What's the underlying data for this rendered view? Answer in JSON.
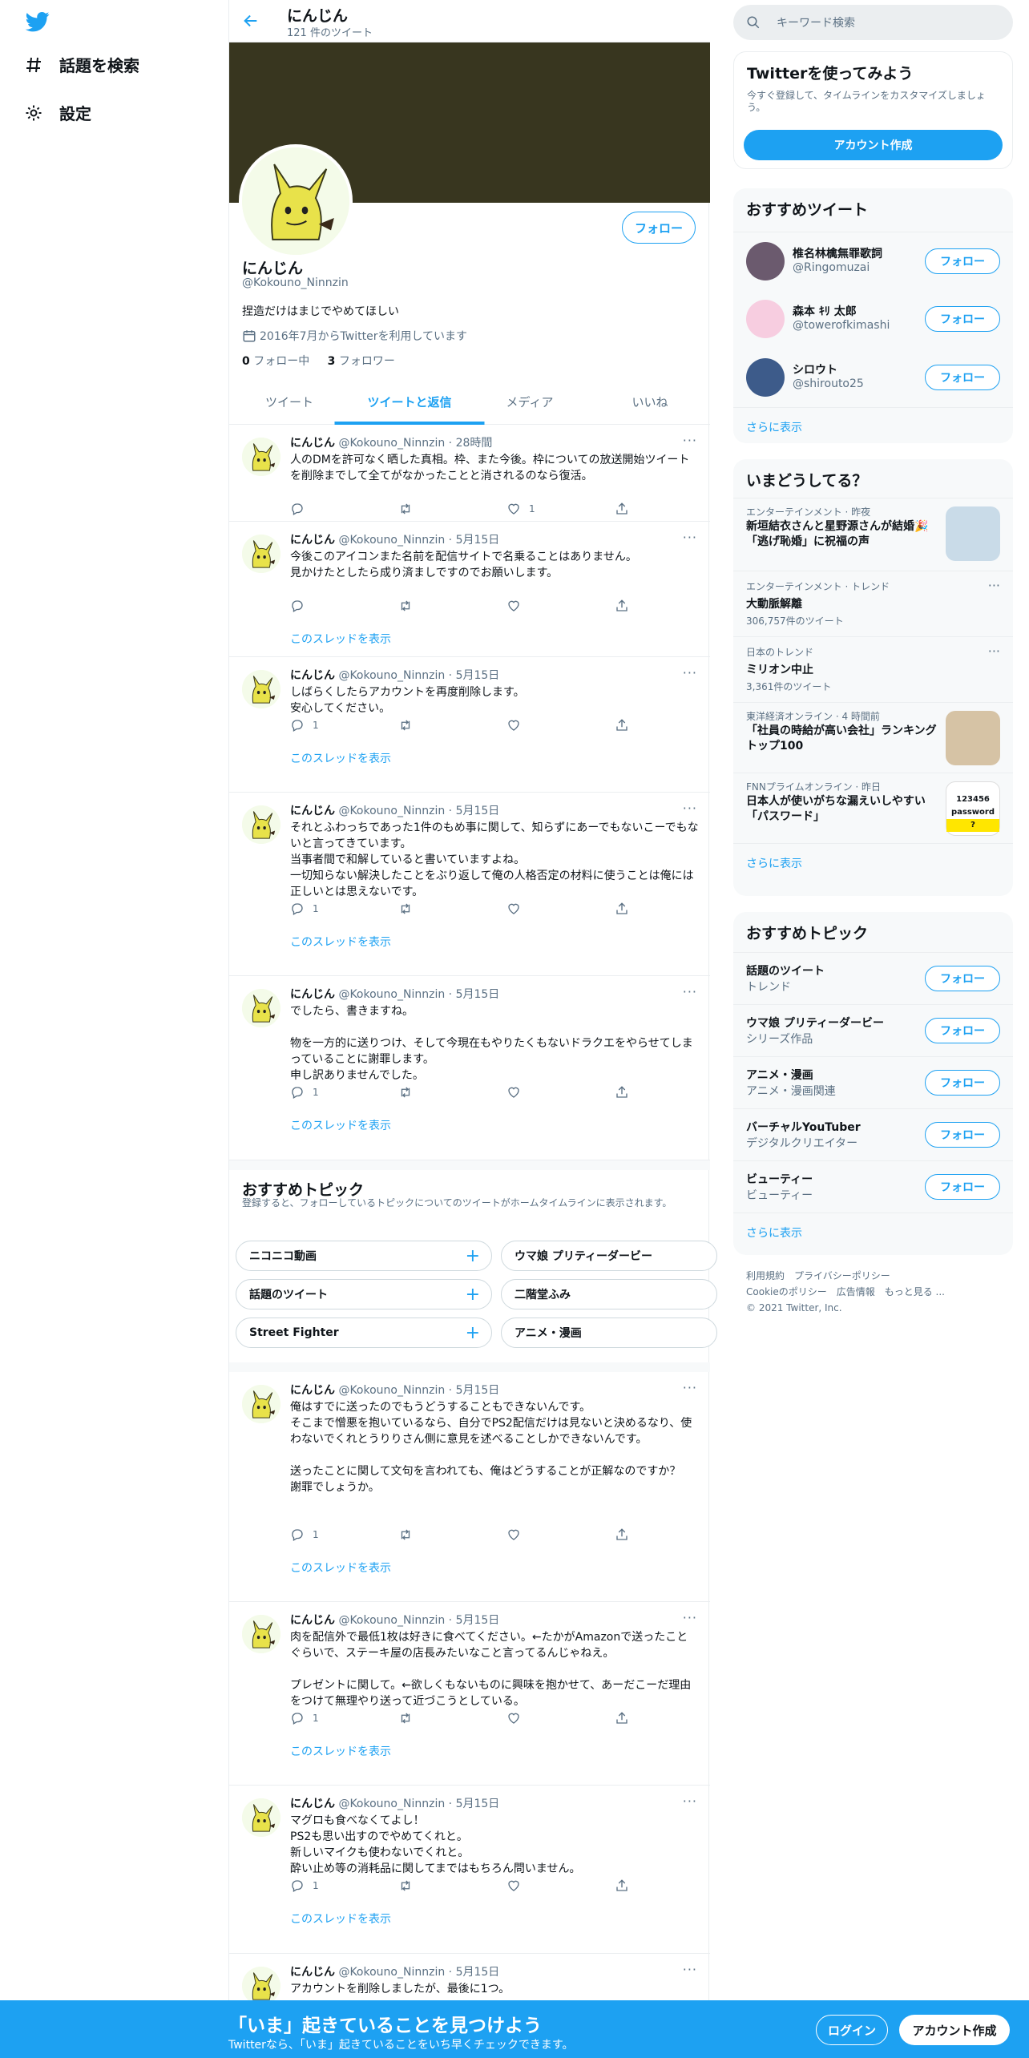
{
  "nav": {
    "explore": "話題を検索",
    "settings": "設定"
  },
  "header": {
    "name": "にんじん",
    "count": "121 件のツイート"
  },
  "profile": {
    "follow": "フォロー",
    "name": "にんじん",
    "handle": "@Kokouno_Ninnzin",
    "bio": "捏造だけはまじでやめてほしい",
    "joined": "2016年7月からTwitterを利用しています",
    "following_num": "0",
    "following_label": "フォロー中",
    "followers_num": "3",
    "followers_label": "フォロワー"
  },
  "tabs": [
    "ツイート",
    "ツイートと返信",
    "メディア",
    "いいね"
  ],
  "thread_label": "このスレッドを表示",
  "tweets": [
    {
      "name": "にんじん",
      "handle": "@Kokouno_Ninnzin",
      "time": "· 28時間",
      "text": "人のDMを許可なく晒した真相。枠、また今後。枠についての放送開始ツイートを削除までして全てがなかったことと消されるのなら復活。",
      "reply": "",
      "rt": "",
      "like": "1"
    },
    {
      "name": "にんじん",
      "handle": "@Kokouno_Ninnzin",
      "time": "· 5月15日",
      "text": "今後このアイコンまた名前を配信サイトで名乗ることはありません。\n見かけたとしたら成り済ましですのでお願いします。",
      "reply": "",
      "rt": "",
      "like": ""
    },
    {
      "name": "にんじん",
      "handle": "@Kokouno_Ninnzin",
      "time": "· 5月15日",
      "text": "しばらくしたらアカウントを再度削除します。\n安心してください。",
      "reply": "1",
      "rt": "",
      "like": ""
    },
    {
      "name": "にんじん",
      "handle": "@Kokouno_Ninnzin",
      "time": "· 5月15日",
      "text": "それとふわっちであった1件のもめ事に関して、知らずにあーでもないこーでもないと言ってきています。\n当事者間で和解していると書いていますよね。\n一切知らない解決したことをぶり返して俺の人格否定の材料に使うことは俺には正しいとは思えないです。",
      "reply": "1",
      "rt": "",
      "like": ""
    },
    {
      "name": "にんじん",
      "handle": "@Kokouno_Ninnzin",
      "time": "· 5月15日",
      "text": "でしたら、書きますね。\n\n物を一方的に送りつけ、そして今現在もやりたくもないドラクエをやらせてしまっていることに謝罪します。\n申し訳ありませんでした。",
      "reply": "1",
      "rt": "",
      "like": ""
    },
    {
      "name": "にんじん",
      "handle": "@Kokouno_Ninnzin",
      "time": "· 5月15日",
      "text": "俺はすでに送ったのでもうどうすることもできないんです。\nそこまで憎悪を抱いているなら、自分でPS2配信だけは見ないと決めるなり、使わないでくれとうりりさん側に意見を述べることしかできないんです。\n\n送ったことに関して文句を言われても、俺はどうすることが正解なのですか？\n謝罪でしょうか。",
      "reply": "1",
      "rt": "",
      "like": ""
    },
    {
      "name": "にんじん",
      "handle": "@Kokouno_Ninnzin",
      "time": "· 5月15日",
      "text": "肉を配信外で最低1枚は好きに食べてください。←たかがAmazonで送ったことぐらいで、ステーキ屋の店長みたいなこと言ってるんじゃねえ。\n\nプレゼントに関して。←欲しくもないものに興味を抱かせて、あーだこーだ理由をつけて無理やり送って近づこうとしている。",
      "reply": "1",
      "rt": "",
      "like": ""
    },
    {
      "name": "にんじん",
      "handle": "@Kokouno_Ninnzin",
      "time": "· 5月15日",
      "text": "マグロも食べなくてよし！\nPS2も思い出すのでやめてくれと。\n新しいマイクも使わないでくれと。\n酔い止め等の消耗品に関してまではもちろん問いません。",
      "reply": "1",
      "rt": "",
      "like": ""
    },
    {
      "name": "にんじん",
      "handle": "@Kokouno_Ninnzin",
      "time": "· 5月15日",
      "text": "アカウントを削除しましたが、最後に1つ。",
      "reply": "",
      "rt": "",
      "like": ""
    }
  ],
  "topics": {
    "title": "おすすめトピック",
    "desc": "登録すると、フォローしているトピックについてのツイートがホームタイムラインに表示されます。",
    "chips": [
      "ニコニコ動画",
      "ウマ娘 プリティーダービー",
      "話題のツイート",
      "二階堂ふみ",
      "Street Fighter",
      "アニメ・漫画"
    ]
  },
  "search": {
    "placeholder": "キーワード検索"
  },
  "signup": {
    "title": "Twitterを使ってみよう",
    "desc": "今すぐ登録して、タイムラインをカスタマイズしましょう。",
    "button": "アカウント作成"
  },
  "whotofollow": {
    "title": "おすすめツイート",
    "users": [
      {
        "name": "椎名林檎無罪歌詞",
        "handle": "@Ringomuzai"
      },
      {
        "name": "森本 ｷﾘ 太郎",
        "handle": "@towerofkimashi"
      },
      {
        "name": "シロウト",
        "handle": "@shirouto25"
      }
    ],
    "button": "フォロー",
    "more": "さらに表示"
  },
  "trends": {
    "title": "いまどうしてる？",
    "items": [
      {
        "meta": "エンターテインメント · 昨夜",
        "title": "新垣結衣さんと星野源さんが結婚🎉「逃げ恥婚」に祝福の声",
        "count": ""
      },
      {
        "meta": "エンターテインメント · トレンド",
        "title": "大動脈解離",
        "count": "306,757件のツイート"
      },
      {
        "meta": "日本のトレンド",
        "title": "ミリオン中止",
        "count": "3,361件のツイート"
      },
      {
        "meta": "東洋経済オンライン · 4 時間前",
        "title": "「社員の時給が高い会社」ランキングトップ100",
        "count": ""
      },
      {
        "meta": "FNNプライムオンライン · 昨日",
        "title": "日本人が使いがちな漏えいしやすい「パスワード」",
        "count": ""
      }
    ],
    "more": "さらに表示",
    "thumb_text": [
      "123456",
      "password",
      "?"
    ]
  },
  "rtopics": {
    "title": "おすすめトピック",
    "items": [
      {
        "name": "話題のツイート",
        "sub": "トレンド"
      },
      {
        "name": "ウマ娘 プリティーダービー",
        "sub": "シリーズ作品"
      },
      {
        "name": "アニメ・漫画",
        "sub": "アニメ・漫画関連"
      },
      {
        "name": "バーチャルYouTuber",
        "sub": "デジタルクリエイター"
      },
      {
        "name": "ビューティー",
        "sub": "ビューティー"
      }
    ],
    "button": "フォロー",
    "more": "さらに表示"
  },
  "footer": {
    "links1": "利用規約　プライバシーポリシー",
    "links2": "Cookieのポリシー　広告情報　もっと見る ...",
    "copy": "© 2021 Twitter, Inc."
  },
  "bottom": {
    "title": "「いま」起きていることを見つけよう",
    "sub": "Twitterなら、「いま」起きていることをいち早くチェックできます。",
    "login": "ログイン",
    "signup": "アカウント作成"
  },
  "colors": {
    "accent": "#1da1f2",
    "banner": "#38361f"
  }
}
